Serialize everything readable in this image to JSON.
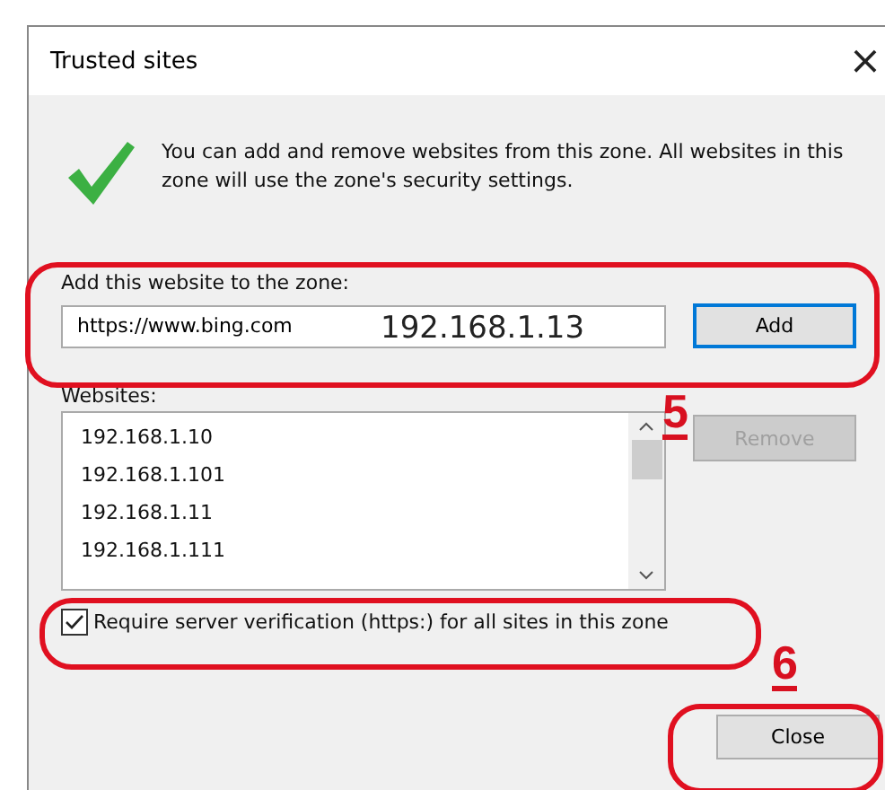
{
  "window": {
    "title": "Trusted sites",
    "close_glyph": "×"
  },
  "info": {
    "message": "You can add and remove websites from this zone. All websites in this zone will use the zone's security settings."
  },
  "add_section": {
    "label": "Add this website to the zone:",
    "value": "https://www.bing.com",
    "button": "Add",
    "focused": true
  },
  "websites": {
    "label": "Websites:",
    "items": [
      "192.168.1.10",
      "192.168.1.101",
      "192.168.1.11",
      "192.168.1.111"
    ],
    "remove_button": "Remove",
    "remove_disabled": true
  },
  "require_https": {
    "label": "Require server verification (https:) for all sites in this zone",
    "checked": true
  },
  "close_button": "Close",
  "annotations": {
    "overlay_text": "192.168.1.13",
    "step_numbers": [
      {
        "label": "5"
      },
      {
        "label": "6"
      }
    ]
  }
}
